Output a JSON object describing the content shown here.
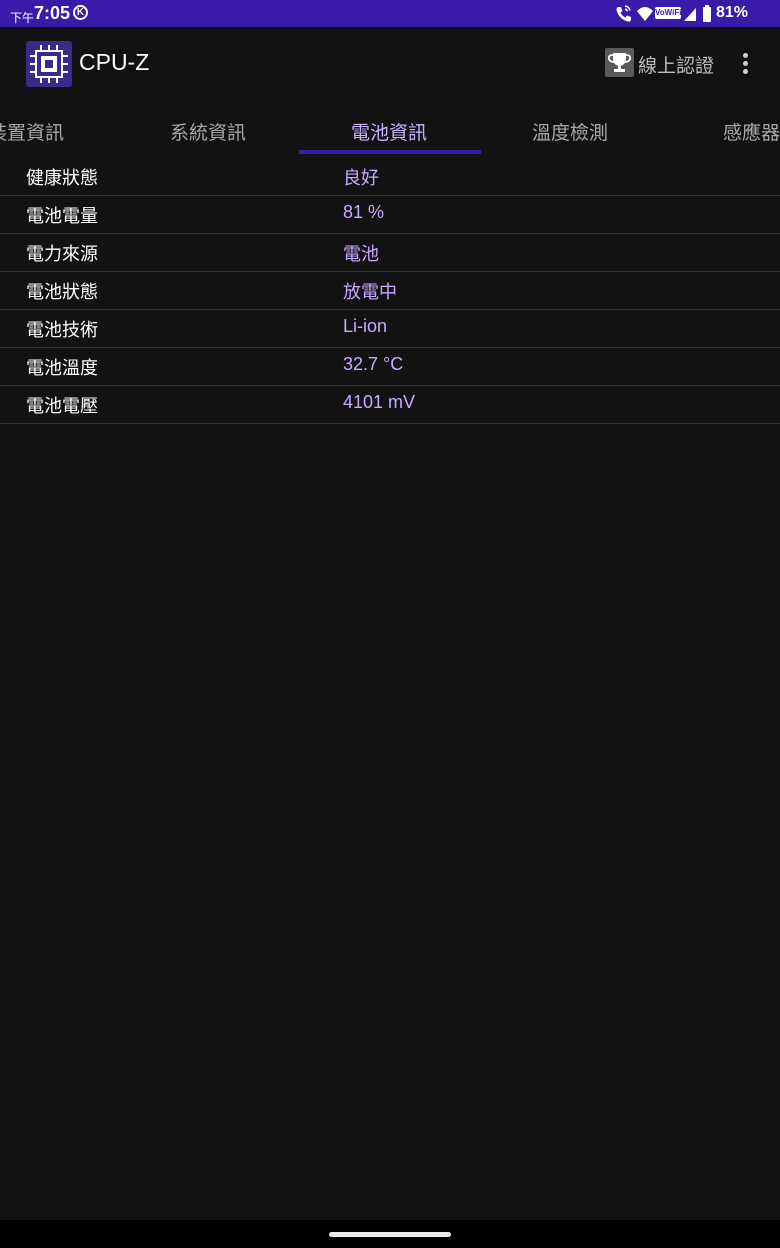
{
  "status_bar": {
    "ampm": "下午",
    "time": "7:05",
    "k_badge": "K",
    "vowifi": "VoWiFi",
    "battery_percent": "81%"
  },
  "app_bar": {
    "title": "CPU-Z",
    "online_validation": "線上認證",
    "icons": [
      "cpu-chip-icon",
      "trophy-icon",
      "more-vert-icon"
    ]
  },
  "tabs": [
    {
      "label": "裝置資訊"
    },
    {
      "label": "系統資訊"
    },
    {
      "label": "電池資訊",
      "active": true
    },
    {
      "label": "溫度檢測"
    },
    {
      "label": "感應器"
    }
  ],
  "battery_info": [
    {
      "key": "健康狀態",
      "value": "良好"
    },
    {
      "key": "電池電量",
      "value": "81 %"
    },
    {
      "key": "電力來源",
      "value": "電池"
    },
    {
      "key": "電池狀態",
      "value": "放電中"
    },
    {
      "key": "電池技術",
      "value": "Li-ion"
    },
    {
      "key": "電池溫度",
      "value": "32.7 °C"
    },
    {
      "key": "電池電壓",
      "value": "4101 mV"
    }
  ],
  "colors": {
    "status_bar": "#3a1aa8",
    "background": "#121212",
    "accent_value": "#c9a9ff",
    "tab_indicator": "#3a1aa8"
  }
}
